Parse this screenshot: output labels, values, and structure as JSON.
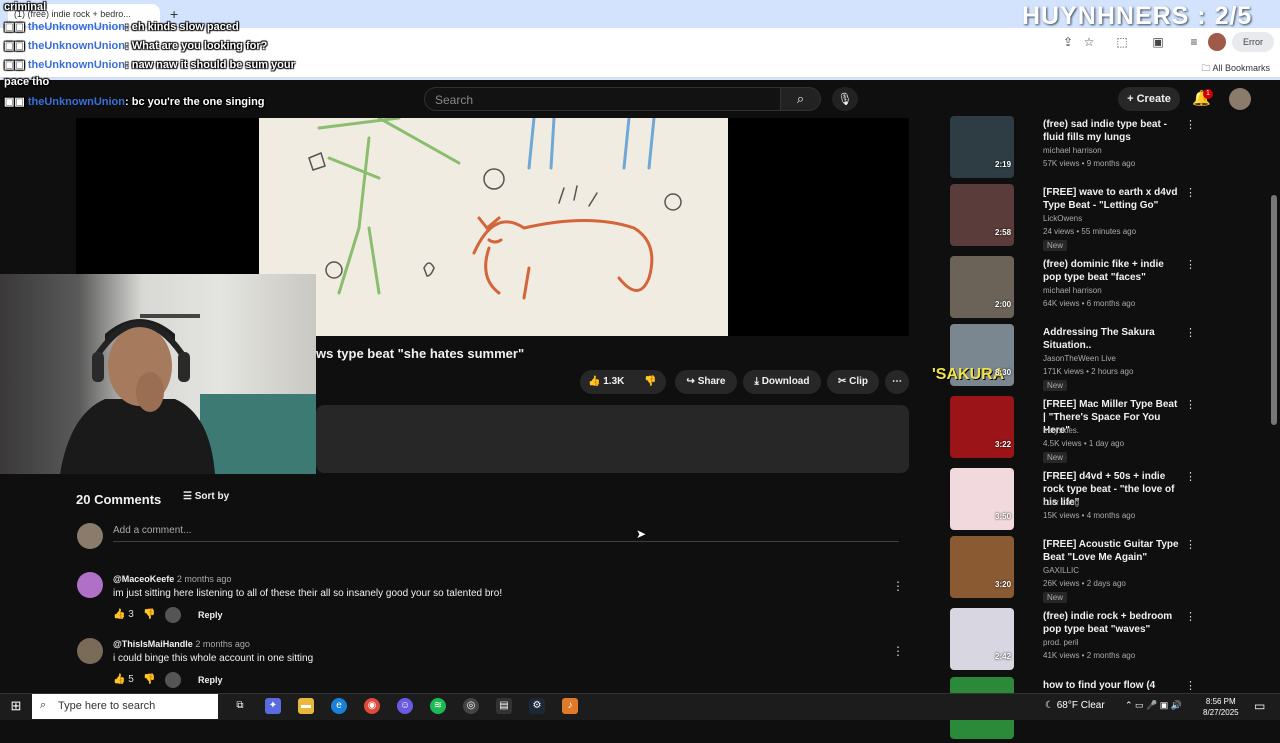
{
  "browser": {
    "tab_title": "(1) (free) indie rock + bedro...",
    "new_tab": "+",
    "error_label": "Error",
    "all_bookmarks": "All Bookmarks"
  },
  "stream_overlay": {
    "score": "HUYNHNERS : 2/5",
    "chat": [
      {
        "prefix": "criminal",
        "user": "",
        "msg": ""
      },
      {
        "prefix": "",
        "user": "theUnknownUnion",
        "msg": ": eh kinds slow paced"
      },
      {
        "prefix": "",
        "user": "theUnknownUnion",
        "msg": ": What are you looking for?"
      },
      {
        "prefix": "",
        "user": "theUnknownUnion",
        "msg": ": naw naw it should be sum your"
      },
      {
        "prefix": "pace tho",
        "user": "",
        "msg": ""
      },
      {
        "prefix": "",
        "user": "theUnknownUnion",
        "msg": ": bc you're the one singing"
      }
    ]
  },
  "youtube_header": {
    "search_placeholder": "Search",
    "create_label": "Create",
    "notification_count": "1"
  },
  "video": {
    "title": "ws type beat \"she hates summer\"",
    "like_count": "1.3K",
    "share_label": "Share",
    "download_label": "Download",
    "clip_label": "Clip"
  },
  "comments": {
    "count_label": "20 Comments",
    "sort_label": "Sort by",
    "add_placeholder": "Add a comment...",
    "items": [
      {
        "author": "@MaceoKeefe",
        "time": "2 months ago",
        "text": "im just sitting here listening to all of these their all so insanely good your so talented bro!",
        "likes": "3",
        "reply": "Reply",
        "avatar_color": "#b070c8"
      },
      {
        "author": "@ThisIsMaiHandle",
        "time": "2 months ago",
        "text": "i could binge this whole account in one sitting",
        "likes": "5",
        "reply": "Reply",
        "avatar_color": "#7a6a58"
      }
    ]
  },
  "recommendations": [
    {
      "title": "(free) sad indie type beat - fluid fills my lungs",
      "channel": "michael harrison",
      "meta": "57K views • 9 months ago",
      "duration": "2:19",
      "new": "",
      "color": "#2e3d44"
    },
    {
      "title": "[FREE] wave to earth x d4vd Type Beat - \"Letting Go\"",
      "channel": "LickOwens",
      "meta": "24 views • 55 minutes ago",
      "duration": "2:58",
      "new": "New",
      "color": "#5a3c3a"
    },
    {
      "title": "(free) dominic fike + indie pop type beat \"faces\"",
      "channel": "michael harrison",
      "meta": "64K views • 6 months ago",
      "duration": "2:00",
      "new": "",
      "color": "#6b6358"
    },
    {
      "title": "Addressing The Sakura Situation..",
      "channel": "JasonTheWeen Live",
      "meta": "171K views • 2 hours ago",
      "duration": "8:30",
      "new": "New",
      "color": "#7a8790",
      "thumb_text": "'SAKURA"
    },
    {
      "title": "[FREE] Mac Miller Type Beat | \"There's Space For You Here\"",
      "channel": "eeryskies.",
      "meta": "4.5K views • 1 day ago",
      "duration": "3:22",
      "new": "New",
      "color": "#9a1418"
    },
    {
      "title": "[FREE] d4vd + 50s + indie rock type beat - \"the love of his life\"",
      "channel": "Luar Lang",
      "meta": "15K views • 4 months ago",
      "duration": "3:50",
      "new": "",
      "color": "#f2d9dd"
    },
    {
      "title": "[FREE] Acoustic Guitar Type Beat \"Love Me Again\"",
      "channel": "GAXILLIC",
      "meta": "26K views • 2 days ago",
      "duration": "3:20",
      "new": "New",
      "color": "#8a5a32"
    },
    {
      "title": "(free) indie rock + bedroom pop type beat \"waves\"",
      "channel": "prod. peril",
      "meta": "41K views • 2 months ago",
      "duration": "2:42",
      "new": "",
      "color": "#d8d6e0"
    },
    {
      "title": "how to find your flow (4 simple",
      "channel": "",
      "meta": "",
      "duration": "",
      "new": "",
      "color": "#2a8a3a"
    }
  ],
  "taskbar": {
    "search_placeholder": "Type here to search",
    "weather": "68°F  Clear",
    "time": "8:56 PM",
    "date": "8/27/2025"
  },
  "colors": {
    "yt_bg": "#0f0f0f",
    "pill": "#272727",
    "chrome": "#d3e3fd",
    "chat_user": "#3a6fd8"
  }
}
